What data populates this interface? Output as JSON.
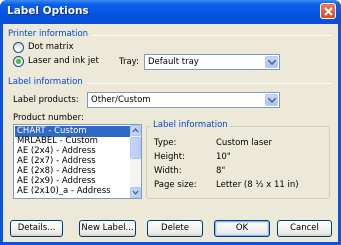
{
  "window": {
    "title": "Label Options"
  },
  "printer_info": {
    "title": "Printer information",
    "options": [
      {
        "label": "Dot matrix",
        "selected": false
      },
      {
        "label": "Laser and ink jet",
        "selected": true
      }
    ],
    "tray_label": "Tray:",
    "tray_value": "Default tray"
  },
  "label_info": {
    "title": "Label information",
    "products_label": "Label products:",
    "products_value": "Other/Custom",
    "product_number_label": "Product number:",
    "product_numbers": [
      "CHART - Custom",
      "MRLABEL - Custom",
      "AE (2x4) - Address",
      "AE (2x7) - Address",
      "AE (2x8) - Address",
      "AE (2x9) - Address",
      "AE (2x10)_a - Address"
    ],
    "selected_index": 0
  },
  "details": {
    "title": "Label information",
    "rows": [
      {
        "key": "Type:",
        "value": "Custom laser"
      },
      {
        "key": "Height:",
        "value": "10\""
      },
      {
        "key": "Width:",
        "value": "8\""
      },
      {
        "key": "Page size:",
        "value": "Letter (8 ½ x 11 in)"
      }
    ]
  },
  "buttons": {
    "details": "Details...",
    "new_label": "New Label...",
    "delete": "Delete",
    "ok": "OK",
    "cancel": "Cancel"
  },
  "colors": {
    "titlebar": "#0553e3",
    "group_title": "#0046d5",
    "selection": "#316ac5"
  }
}
